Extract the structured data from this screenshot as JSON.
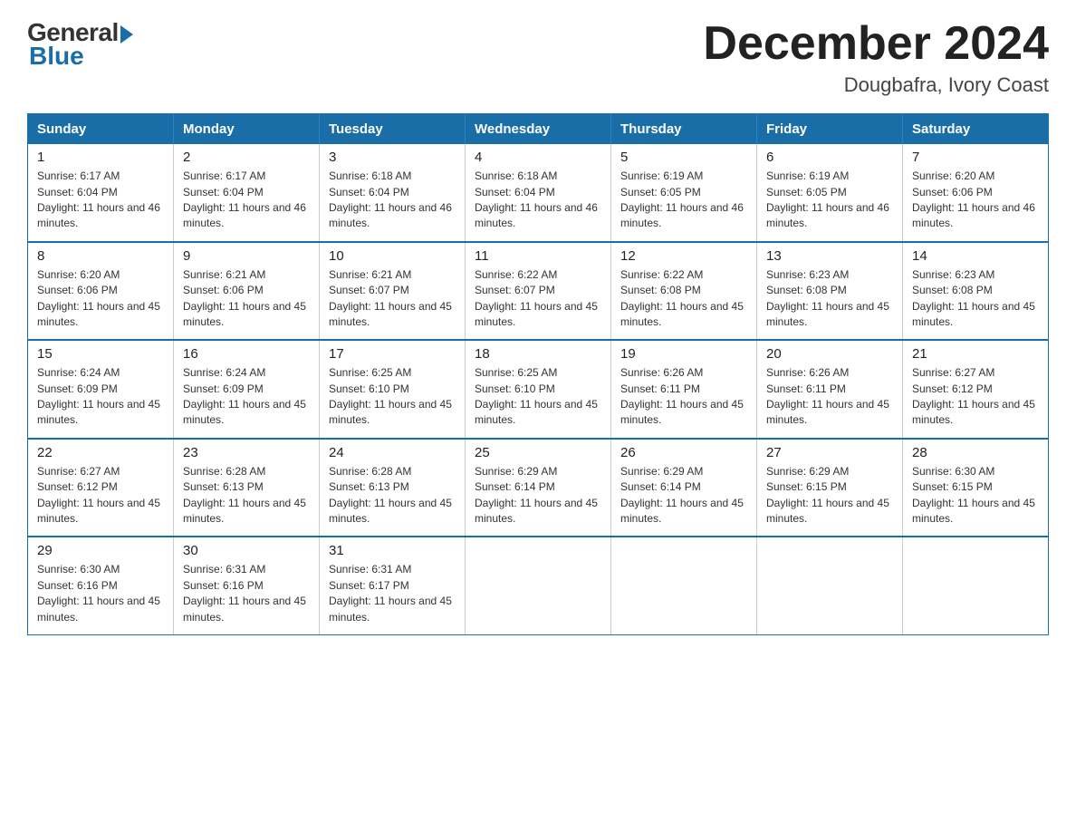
{
  "logo": {
    "general_text": "General",
    "blue_text": "Blue"
  },
  "title": {
    "month_year": "December 2024",
    "location": "Dougbafra, Ivory Coast"
  },
  "days_of_week": [
    "Sunday",
    "Monday",
    "Tuesday",
    "Wednesday",
    "Thursday",
    "Friday",
    "Saturday"
  ],
  "weeks": [
    [
      {
        "day": "1",
        "sunrise": "Sunrise: 6:17 AM",
        "sunset": "Sunset: 6:04 PM",
        "daylight": "Daylight: 11 hours and 46 minutes."
      },
      {
        "day": "2",
        "sunrise": "Sunrise: 6:17 AM",
        "sunset": "Sunset: 6:04 PM",
        "daylight": "Daylight: 11 hours and 46 minutes."
      },
      {
        "day": "3",
        "sunrise": "Sunrise: 6:18 AM",
        "sunset": "Sunset: 6:04 PM",
        "daylight": "Daylight: 11 hours and 46 minutes."
      },
      {
        "day": "4",
        "sunrise": "Sunrise: 6:18 AM",
        "sunset": "Sunset: 6:04 PM",
        "daylight": "Daylight: 11 hours and 46 minutes."
      },
      {
        "day": "5",
        "sunrise": "Sunrise: 6:19 AM",
        "sunset": "Sunset: 6:05 PM",
        "daylight": "Daylight: 11 hours and 46 minutes."
      },
      {
        "day": "6",
        "sunrise": "Sunrise: 6:19 AM",
        "sunset": "Sunset: 6:05 PM",
        "daylight": "Daylight: 11 hours and 46 minutes."
      },
      {
        "day": "7",
        "sunrise": "Sunrise: 6:20 AM",
        "sunset": "Sunset: 6:06 PM",
        "daylight": "Daylight: 11 hours and 46 minutes."
      }
    ],
    [
      {
        "day": "8",
        "sunrise": "Sunrise: 6:20 AM",
        "sunset": "Sunset: 6:06 PM",
        "daylight": "Daylight: 11 hours and 45 minutes."
      },
      {
        "day": "9",
        "sunrise": "Sunrise: 6:21 AM",
        "sunset": "Sunset: 6:06 PM",
        "daylight": "Daylight: 11 hours and 45 minutes."
      },
      {
        "day": "10",
        "sunrise": "Sunrise: 6:21 AM",
        "sunset": "Sunset: 6:07 PM",
        "daylight": "Daylight: 11 hours and 45 minutes."
      },
      {
        "day": "11",
        "sunrise": "Sunrise: 6:22 AM",
        "sunset": "Sunset: 6:07 PM",
        "daylight": "Daylight: 11 hours and 45 minutes."
      },
      {
        "day": "12",
        "sunrise": "Sunrise: 6:22 AM",
        "sunset": "Sunset: 6:08 PM",
        "daylight": "Daylight: 11 hours and 45 minutes."
      },
      {
        "day": "13",
        "sunrise": "Sunrise: 6:23 AM",
        "sunset": "Sunset: 6:08 PM",
        "daylight": "Daylight: 11 hours and 45 minutes."
      },
      {
        "day": "14",
        "sunrise": "Sunrise: 6:23 AM",
        "sunset": "Sunset: 6:08 PM",
        "daylight": "Daylight: 11 hours and 45 minutes."
      }
    ],
    [
      {
        "day": "15",
        "sunrise": "Sunrise: 6:24 AM",
        "sunset": "Sunset: 6:09 PM",
        "daylight": "Daylight: 11 hours and 45 minutes."
      },
      {
        "day": "16",
        "sunrise": "Sunrise: 6:24 AM",
        "sunset": "Sunset: 6:09 PM",
        "daylight": "Daylight: 11 hours and 45 minutes."
      },
      {
        "day": "17",
        "sunrise": "Sunrise: 6:25 AM",
        "sunset": "Sunset: 6:10 PM",
        "daylight": "Daylight: 11 hours and 45 minutes."
      },
      {
        "day": "18",
        "sunrise": "Sunrise: 6:25 AM",
        "sunset": "Sunset: 6:10 PM",
        "daylight": "Daylight: 11 hours and 45 minutes."
      },
      {
        "day": "19",
        "sunrise": "Sunrise: 6:26 AM",
        "sunset": "Sunset: 6:11 PM",
        "daylight": "Daylight: 11 hours and 45 minutes."
      },
      {
        "day": "20",
        "sunrise": "Sunrise: 6:26 AM",
        "sunset": "Sunset: 6:11 PM",
        "daylight": "Daylight: 11 hours and 45 minutes."
      },
      {
        "day": "21",
        "sunrise": "Sunrise: 6:27 AM",
        "sunset": "Sunset: 6:12 PM",
        "daylight": "Daylight: 11 hours and 45 minutes."
      }
    ],
    [
      {
        "day": "22",
        "sunrise": "Sunrise: 6:27 AM",
        "sunset": "Sunset: 6:12 PM",
        "daylight": "Daylight: 11 hours and 45 minutes."
      },
      {
        "day": "23",
        "sunrise": "Sunrise: 6:28 AM",
        "sunset": "Sunset: 6:13 PM",
        "daylight": "Daylight: 11 hours and 45 minutes."
      },
      {
        "day": "24",
        "sunrise": "Sunrise: 6:28 AM",
        "sunset": "Sunset: 6:13 PM",
        "daylight": "Daylight: 11 hours and 45 minutes."
      },
      {
        "day": "25",
        "sunrise": "Sunrise: 6:29 AM",
        "sunset": "Sunset: 6:14 PM",
        "daylight": "Daylight: 11 hours and 45 minutes."
      },
      {
        "day": "26",
        "sunrise": "Sunrise: 6:29 AM",
        "sunset": "Sunset: 6:14 PM",
        "daylight": "Daylight: 11 hours and 45 minutes."
      },
      {
        "day": "27",
        "sunrise": "Sunrise: 6:29 AM",
        "sunset": "Sunset: 6:15 PM",
        "daylight": "Daylight: 11 hours and 45 minutes."
      },
      {
        "day": "28",
        "sunrise": "Sunrise: 6:30 AM",
        "sunset": "Sunset: 6:15 PM",
        "daylight": "Daylight: 11 hours and 45 minutes."
      }
    ],
    [
      {
        "day": "29",
        "sunrise": "Sunrise: 6:30 AM",
        "sunset": "Sunset: 6:16 PM",
        "daylight": "Daylight: 11 hours and 45 minutes."
      },
      {
        "day": "30",
        "sunrise": "Sunrise: 6:31 AM",
        "sunset": "Sunset: 6:16 PM",
        "daylight": "Daylight: 11 hours and 45 minutes."
      },
      {
        "day": "31",
        "sunrise": "Sunrise: 6:31 AM",
        "sunset": "Sunset: 6:17 PM",
        "daylight": "Daylight: 11 hours and 45 minutes."
      },
      null,
      null,
      null,
      null
    ]
  ]
}
